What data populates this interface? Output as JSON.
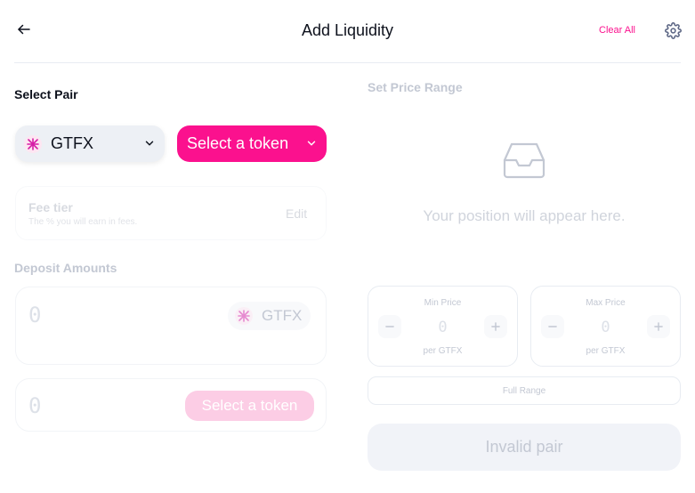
{
  "header": {
    "title": "Add Liquidity",
    "clear_all": "Clear All",
    "back_icon": "arrow-left-icon",
    "settings_icon": "gear-icon"
  },
  "pair": {
    "label": "Select Pair",
    "token_a": {
      "symbol": "GTFX",
      "icon": "gtfx-logo-icon"
    },
    "token_b": {
      "label": "Select a token"
    }
  },
  "fee_tier": {
    "title": "Fee tier",
    "subtitle": "The % you will earn in fees.",
    "edit_label": "Edit"
  },
  "deposit": {
    "label": "Deposit Amounts",
    "input_a": {
      "value": "0",
      "token": "GTFX"
    },
    "input_b": {
      "value": "0",
      "select_label": "Select a token"
    }
  },
  "price_range": {
    "label": "Set Price Range",
    "empty_message": "Your position will appear here.",
    "empty_icon": "inbox-icon",
    "min": {
      "label": "Min Price",
      "value": "0",
      "unit": "per GTFX"
    },
    "max": {
      "label": "Max Price",
      "value": "0",
      "unit": "per GTFX"
    },
    "full_range": "Full Range"
  },
  "submit": {
    "label": "Invalid pair"
  },
  "colors": {
    "accent": "#fb118e",
    "accent_light": "#fccde5",
    "muted_text": "#c3c8d3",
    "border": "#e8ecf2"
  }
}
